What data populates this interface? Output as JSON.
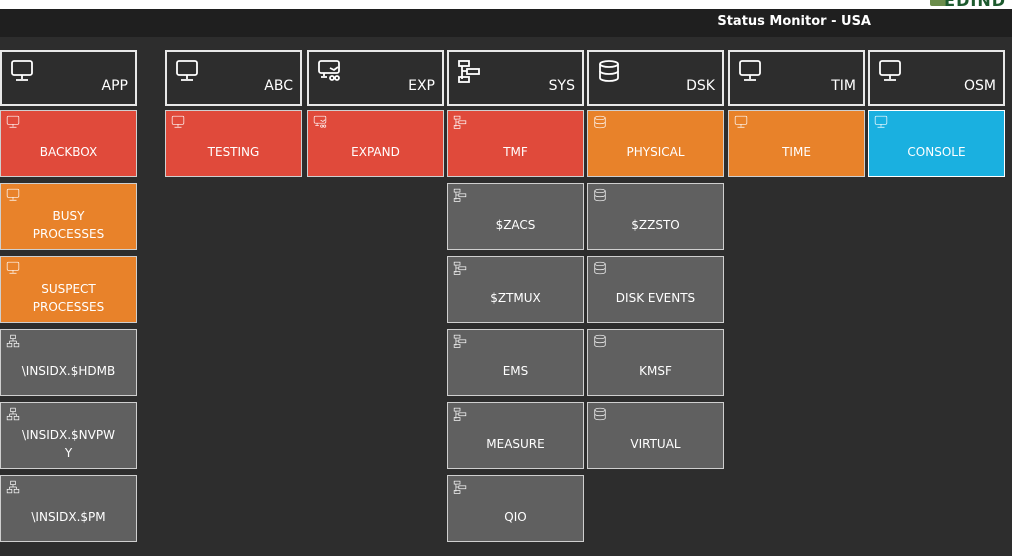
{
  "app": {
    "title": "Status Monitor - USA",
    "logo_text": "EDIND"
  },
  "colors": {
    "critical": "#e04a3b",
    "warning": "#e8822a",
    "normal": "#606060",
    "info": "#1ab0e0"
  },
  "columns": [
    {
      "label": "APP",
      "icon": "monitor-icon",
      "tiles": [
        {
          "label": "BACKBOX",
          "status": "critical",
          "icon": "monitor-icon"
        },
        {
          "label": "BUSY\nPROCESSES",
          "status": "warning",
          "icon": "monitor-icon"
        },
        {
          "label": "SUSPECT\nPROCESSES",
          "status": "warning",
          "icon": "monitor-icon"
        },
        {
          "label": "\\INSIDX.$HDMB",
          "status": "normal",
          "icon": "network-icon"
        },
        {
          "label": "\\INSIDX.$NVPW\nY",
          "status": "normal",
          "icon": "network-icon"
        },
        {
          "label": "\\INSIDX.$PM",
          "status": "normal",
          "icon": "network-icon"
        }
      ]
    },
    {
      "label": "ABC",
      "icon": "monitor-icon",
      "tiles": [
        {
          "label": "TESTING",
          "status": "critical",
          "icon": "monitor-icon"
        }
      ]
    },
    {
      "label": "EXP",
      "icon": "monitor-network-icon",
      "tiles": [
        {
          "label": "EXPAND",
          "status": "critical",
          "icon": "monitor-network-icon"
        }
      ]
    },
    {
      "label": "SYS",
      "icon": "hierarchy-icon",
      "tiles": [
        {
          "label": "TMF",
          "status": "critical",
          "icon": "hierarchy-icon"
        },
        {
          "label": "$ZACS",
          "status": "normal",
          "icon": "hierarchy-icon"
        },
        {
          "label": "$ZTMUX",
          "status": "normal",
          "icon": "hierarchy-icon"
        },
        {
          "label": "EMS",
          "status": "normal",
          "icon": "hierarchy-icon"
        },
        {
          "label": "MEASURE",
          "status": "normal",
          "icon": "hierarchy-icon"
        },
        {
          "label": "QIO",
          "status": "normal",
          "icon": "hierarchy-icon"
        }
      ]
    },
    {
      "label": "DSK",
      "icon": "database-icon",
      "tiles": [
        {
          "label": "PHYSICAL",
          "status": "warning",
          "icon": "database-icon"
        },
        {
          "label": "$ZZSTO",
          "status": "normal",
          "icon": "database-icon"
        },
        {
          "label": "DISK EVENTS",
          "status": "normal",
          "icon": "database-icon"
        },
        {
          "label": "KMSF",
          "status": "normal",
          "icon": "database-icon"
        },
        {
          "label": "VIRTUAL",
          "status": "normal",
          "icon": "database-icon"
        }
      ]
    },
    {
      "label": "TIM",
      "icon": "monitor-icon",
      "tiles": [
        {
          "label": "TIME",
          "status": "warning",
          "icon": "monitor-icon"
        }
      ]
    },
    {
      "label": "OSM",
      "icon": "monitor-icon",
      "tiles": [
        {
          "label": "CONSOLE",
          "status": "info",
          "icon": "monitor-icon"
        }
      ]
    }
  ]
}
